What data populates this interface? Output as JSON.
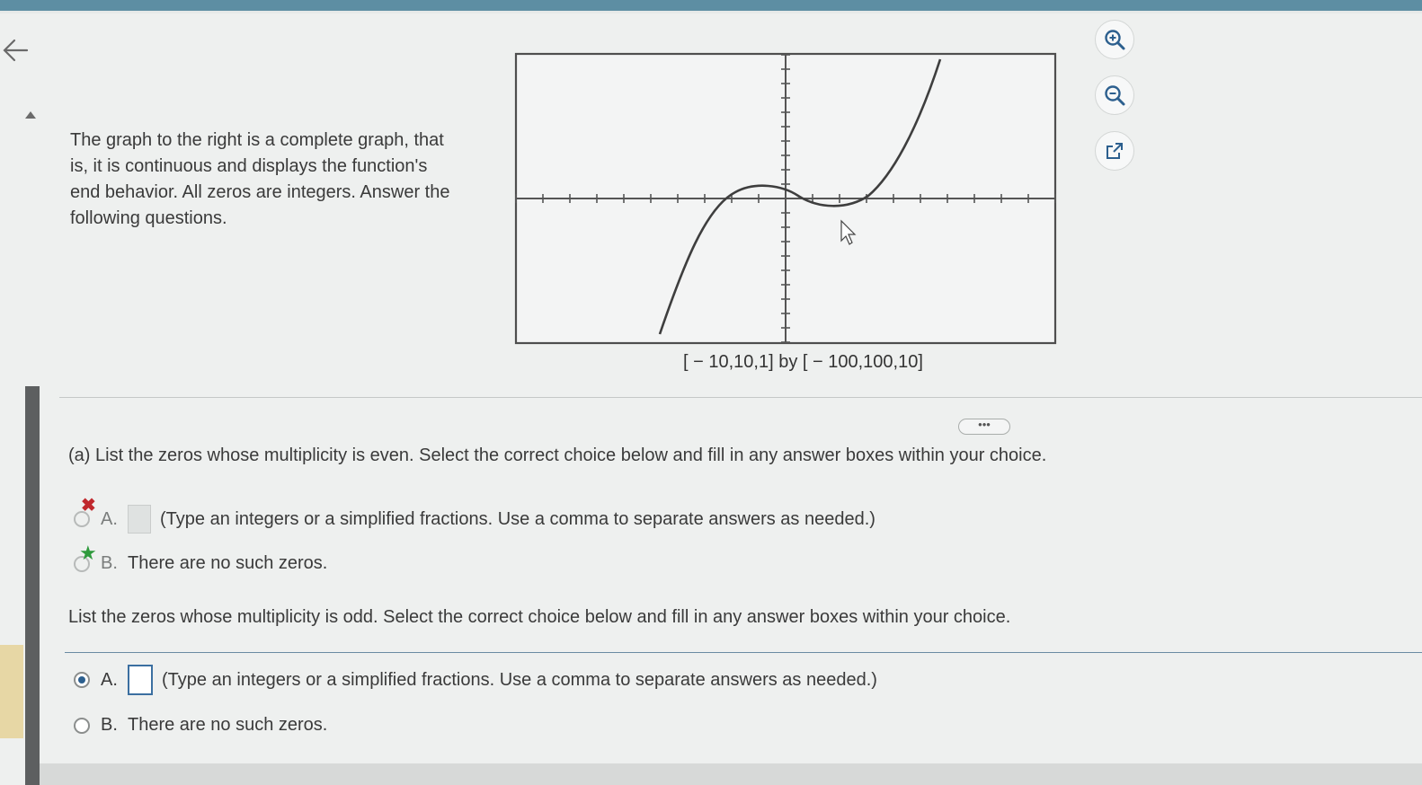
{
  "question": {
    "text": "The graph to the right is a complete graph, that is, it is continuous and displays the function's end behavior. All zeros are integers. Answer the following questions."
  },
  "graph": {
    "window_label": "[ − 10,10,1] by [ − 100,100,10]"
  },
  "tools": {
    "zoom_in": "zoom-in-icon",
    "zoom_out": "zoom-out-icon",
    "popout": "external-link-icon"
  },
  "more_label": "•••",
  "part_a": {
    "prompt": "(a) List the zeros whose multiplicity is even. Select the correct choice below and fill in any answer boxes within your choice.",
    "choice_a_letter": "A.",
    "choice_a_text": "(Type an integers or a simplified fractions. Use a comma to separate answers as needed.)",
    "choice_b_letter": "B.",
    "choice_b_text": "There are no such zeros.",
    "incorrect_mark": "✖",
    "correct_mark": "★"
  },
  "part_b": {
    "prompt": "List the zeros whose multiplicity is odd. Select the correct choice below and fill in any answer boxes within your choice.",
    "choice_a_letter": "A.",
    "choice_a_text": "(Type an integers or a simplified fractions. Use a comma to separate answers as needed.)",
    "choice_b_letter": "B.",
    "choice_b_text": "There are no such zeros."
  },
  "colors": {
    "accent": "#2c5f8e",
    "incorrect": "#c0282d",
    "correct": "#2e9a3c"
  }
}
